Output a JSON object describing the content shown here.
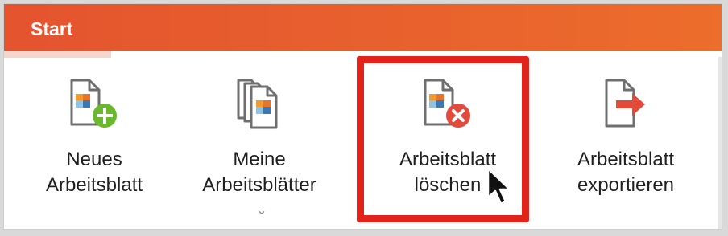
{
  "ribbon": {
    "tab_label": "Start",
    "colors": {
      "ribbon_start": "#e4542f",
      "ribbon_end": "#ec6d2c",
      "tab_underline": "#f6d5cb"
    }
  },
  "tools": [
    {
      "line1": "Neues",
      "line2": "Arbeitsblatt",
      "icon": "new-worksheet-icon"
    },
    {
      "line1": "Meine",
      "line2": "Arbeitsblätter",
      "icon": "my-worksheets-icon",
      "has_dropdown": true,
      "dropdown_icon": "chevron-down-icon"
    },
    {
      "line1": "Arbeitsblatt",
      "line2": "löschen",
      "icon": "delete-worksheet-icon",
      "highlighted": true
    },
    {
      "line1": "Arbeitsblatt",
      "line2": "exportieren",
      "icon": "export-worksheet-icon"
    }
  ],
  "highlight_color": "#e2231a",
  "cursor_icon": "mouse-pointer-icon"
}
